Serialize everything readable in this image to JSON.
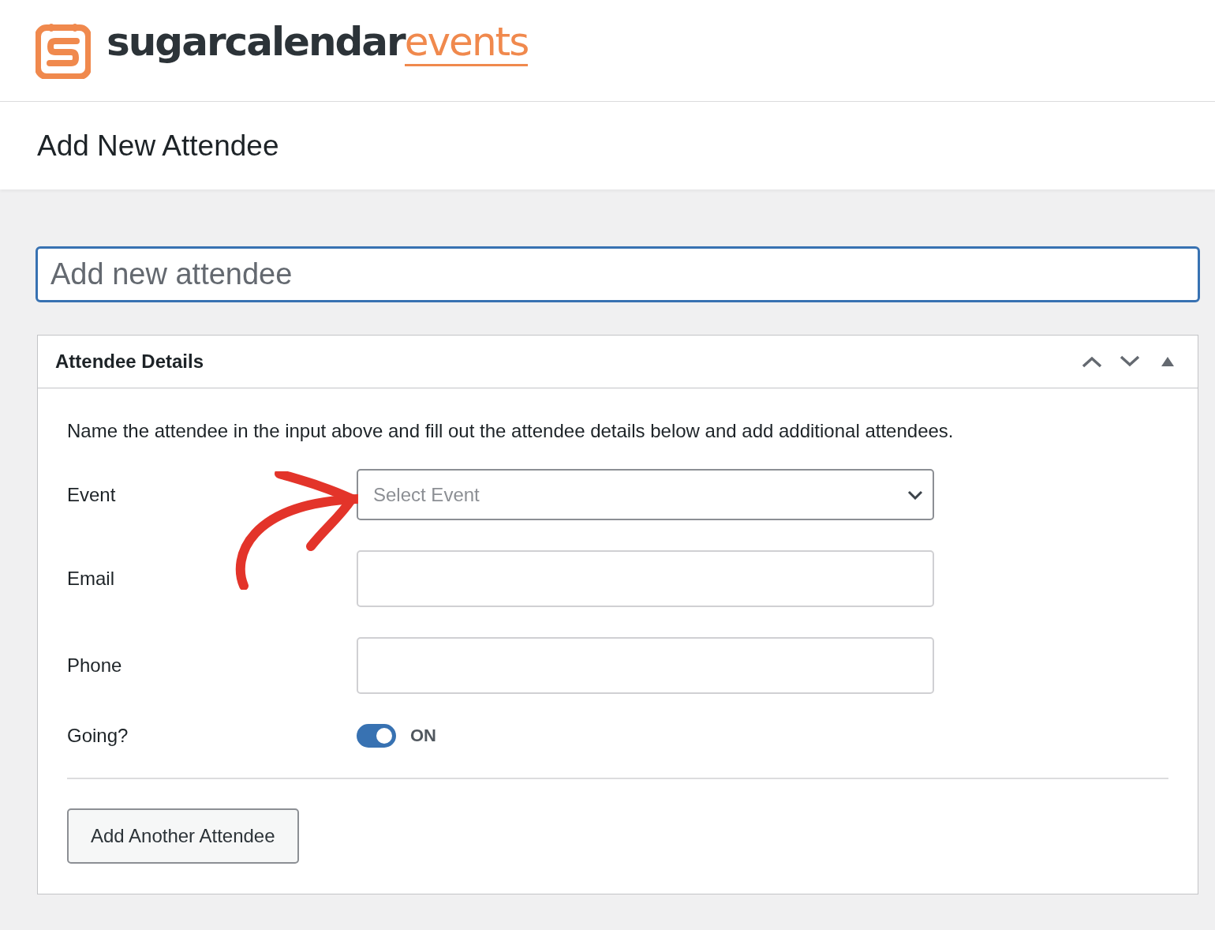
{
  "logo": {
    "name": "sugarcalendar",
    "suffix": "events"
  },
  "page_title": "Add New Attendee",
  "title_field": {
    "placeholder": "Add new attendee"
  },
  "panel": {
    "title": "Attendee Details",
    "intro": "Name the attendee in the input above and fill out the attendee details below and add additional attendees.",
    "fields": [
      {
        "kind": "select",
        "label": "Event",
        "placeholder": "Select Event"
      },
      {
        "kind": "text",
        "label": "Email"
      },
      {
        "kind": "text",
        "label": "Phone"
      },
      {
        "kind": "toggle",
        "label": "Going?",
        "on": true,
        "state_label": "ON"
      }
    ],
    "button": "Add Another Attendee"
  }
}
